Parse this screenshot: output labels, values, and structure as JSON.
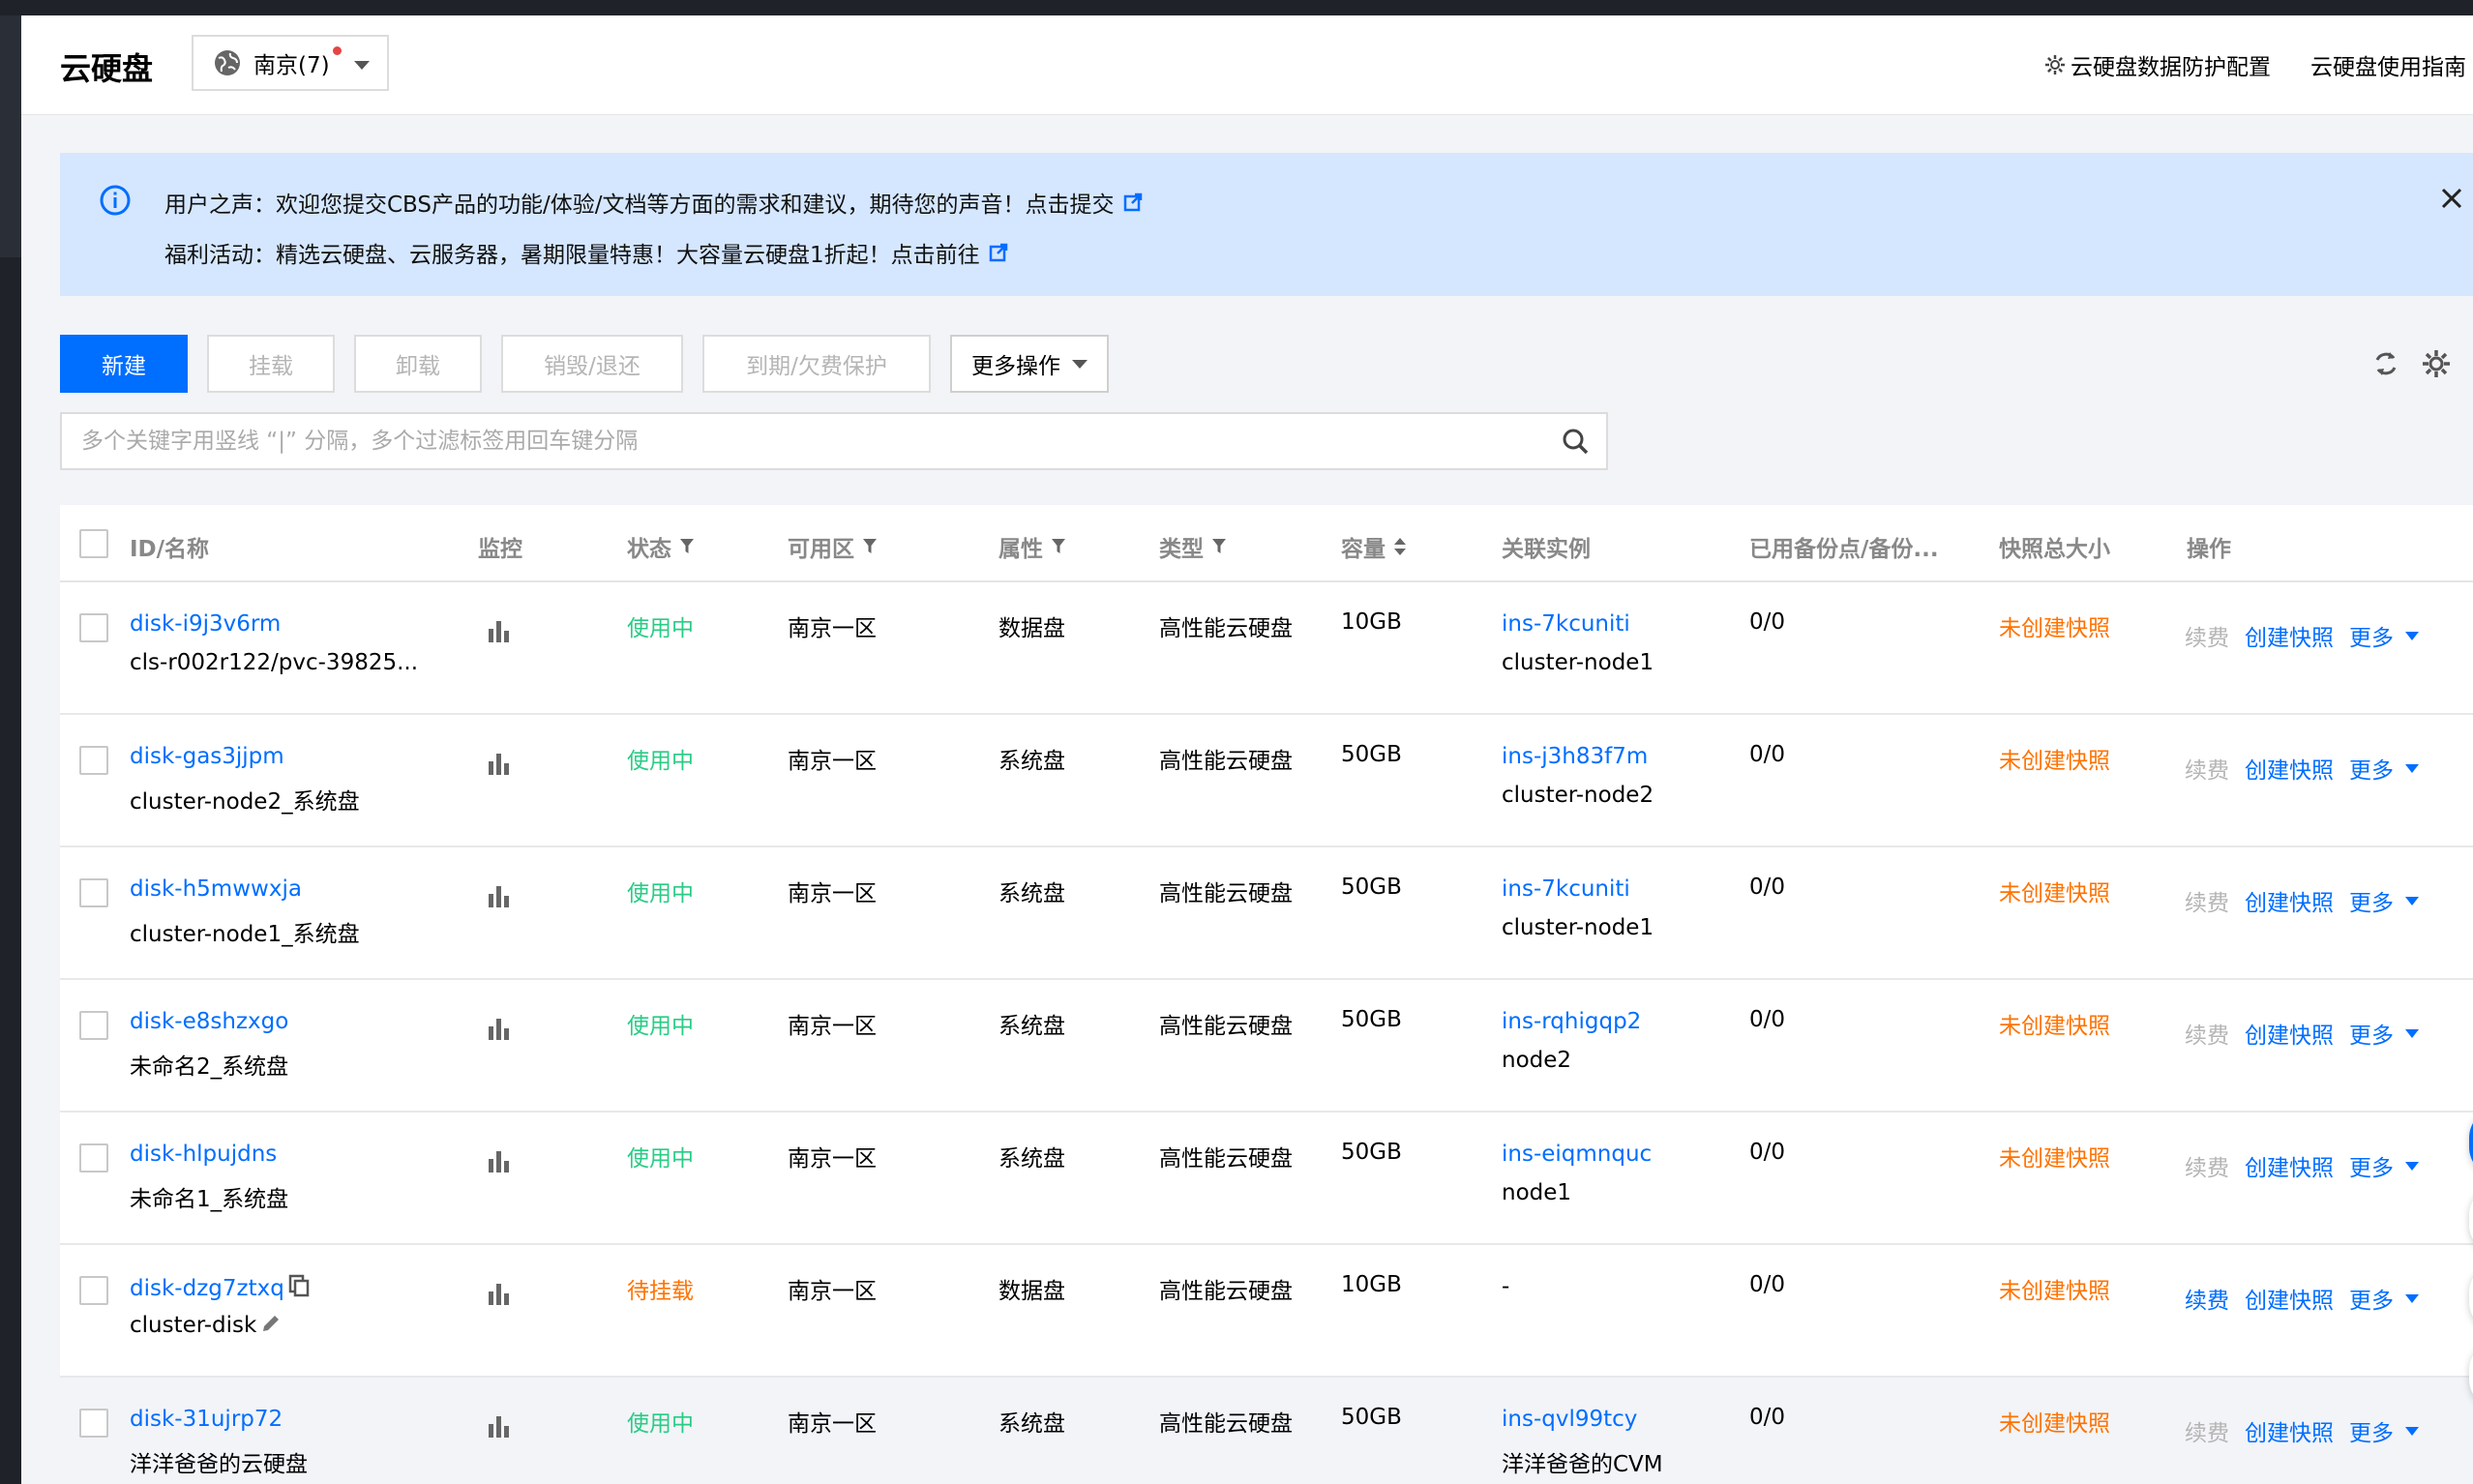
{
  "header": {
    "title": "云硬盘",
    "region_label": "南京(7)",
    "protect_config_label": "云硬盘数据防护配置",
    "guide_label": "云硬盘使用指南"
  },
  "notice": {
    "line1": "用户之声：欢迎您提交CBS产品的功能/体验/文档等方面的需求和建议，期待您的声音！点击提交",
    "line2": "福利活动：精选云硬盘、云服务器，暑期限量特惠！大容量云硬盘1折起！点击前往"
  },
  "toolbar": {
    "new_label": "新建",
    "attach_label": "挂载",
    "detach_label": "卸载",
    "destroy_label": "销毁/退还",
    "expire_label": "到期/欠费保护",
    "more_label": "更多操作"
  },
  "search": {
    "placeholder": "多个关键字用竖线 “|” 分隔，多个过滤标签用回车键分隔"
  },
  "table": {
    "columns": {
      "id_name": "ID/名称",
      "monitor": "监控",
      "status": "状态",
      "zone": "可用区",
      "attribute": "属性",
      "type": "类型",
      "capacity": "容量",
      "instance": "关联实例",
      "backup": "已用备份点/备份...",
      "snapshot": "快照总大小",
      "ops": "操作"
    },
    "rows": [
      {
        "id": "disk-i9j3v6rm",
        "name": "cls-r002r122/pvc-39825...",
        "status": "使用中",
        "zone": "南京一区",
        "attribute": "数据盘",
        "type": "高性能云硬盘",
        "capacity": "10GB",
        "instance_id": "ins-7kcuniti",
        "instance_name": "cluster-node1",
        "backup": "0/0",
        "snapshot": "未创建快照",
        "renew": "续费",
        "create_snapshot": "创建快照",
        "more": "更多"
      },
      {
        "id": "disk-gas3jjpm",
        "name": "cluster-node2_系统盘",
        "status": "使用中",
        "zone": "南京一区",
        "attribute": "系统盘",
        "type": "高性能云硬盘",
        "capacity": "50GB",
        "instance_id": "ins-j3h83f7m",
        "instance_name": "cluster-node2",
        "backup": "0/0",
        "snapshot": "未创建快照",
        "renew": "续费",
        "create_snapshot": "创建快照",
        "more": "更多"
      },
      {
        "id": "disk-h5mwwxja",
        "name": "cluster-node1_系统盘",
        "status": "使用中",
        "zone": "南京一区",
        "attribute": "系统盘",
        "type": "高性能云硬盘",
        "capacity": "50GB",
        "instance_id": "ins-7kcuniti",
        "instance_name": "cluster-node1",
        "backup": "0/0",
        "snapshot": "未创建快照",
        "renew": "续费",
        "create_snapshot": "创建快照",
        "more": "更多"
      },
      {
        "id": "disk-e8shzxgo",
        "name": "未命名2_系统盘",
        "status": "使用中",
        "zone": "南京一区",
        "attribute": "系统盘",
        "type": "高性能云硬盘",
        "capacity": "50GB",
        "instance_id": "ins-rqhigqp2",
        "instance_name": "node2",
        "backup": "0/0",
        "snapshot": "未创建快照",
        "renew": "续费",
        "create_snapshot": "创建快照",
        "more": "更多"
      },
      {
        "id": "disk-hlpujdns",
        "name": "未命名1_系统盘",
        "status": "使用中",
        "zone": "南京一区",
        "attribute": "系统盘",
        "type": "高性能云硬盘",
        "capacity": "50GB",
        "instance_id": "ins-eiqmnquc",
        "instance_name": "node1",
        "backup": "0/0",
        "snapshot": "未创建快照",
        "renew": "续费",
        "create_snapshot": "创建快照",
        "more": "更多"
      },
      {
        "id": "disk-dzg7ztxq",
        "name": "cluster-disk",
        "status": "待挂载",
        "zone": "南京一区",
        "attribute": "数据盘",
        "type": "高性能云硬盘",
        "capacity": "10GB",
        "instance_id": "-",
        "instance_name": "",
        "backup": "0/0",
        "snapshot": "未创建快照",
        "renew": "续费",
        "create_snapshot": "创建快照",
        "more": "更多"
      },
      {
        "id": "disk-31ujrp72",
        "name": "洋洋爸爸的云硬盘",
        "status": "使用中",
        "zone": "南京一区",
        "attribute": "系统盘",
        "type": "高性能云硬盘",
        "capacity": "50GB",
        "instance_id": "ins-qvl99tcy",
        "instance_name": "洋洋爸爸的CVM",
        "backup": "0/0",
        "snapshot": "未创建快照",
        "renew": "续费",
        "create_snapshot": "创建快照",
        "more": "更多"
      }
    ]
  },
  "colors": {
    "primary": "#006eff",
    "status_in_use": "#29cc85",
    "status_pending": "#ff7200",
    "snapshot_none": "#ff7200",
    "notice_bg": "#d5e7ff"
  },
  "icons": [
    "globe-icon",
    "gear-icon",
    "info-icon",
    "external-link-icon",
    "close-icon",
    "refresh-icon",
    "settings-icon",
    "search-icon",
    "filter-icon",
    "sort-icon",
    "bar-chart-icon",
    "copy-icon",
    "edit-icon",
    "caret-down-icon"
  ]
}
